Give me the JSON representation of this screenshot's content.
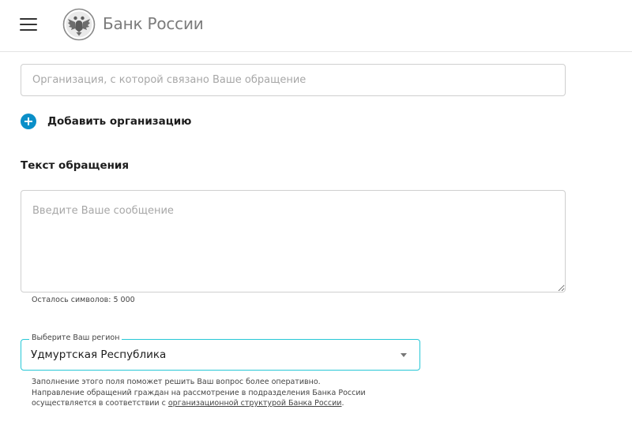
{
  "header": {
    "brand": "Банк России",
    "menu_icon": "hamburger-menu-icon",
    "logo_icon": "bank-of-russia-eagle-emblem"
  },
  "form": {
    "organization": {
      "placeholder": "Организация, с которой связано Ваше обращение",
      "value": ""
    },
    "add_organization": {
      "label": "Добавить организацию",
      "icon": "plus-circle-icon",
      "icon_color": "#0a8fc8"
    },
    "message_section": {
      "title": "Текст обращения",
      "placeholder": "Введите Ваше сообщение",
      "value": "",
      "counter": "Осталось символов: 5 000"
    },
    "region": {
      "label": "Выберите Ваш регион",
      "selected": "Удмуртская Республика",
      "border_color": "#27c7d6",
      "hint_line1": "Заполнение этого поля поможет решить Ваш вопрос более оперативно.",
      "hint_line2": "Направление обращений граждан на рассмотрение в подразделения Банка России",
      "hint_line3_prefix": "осуществляется в соответствии с ",
      "hint_link": "организационной структурой Банка России",
      "hint_line3_suffix": "."
    }
  }
}
